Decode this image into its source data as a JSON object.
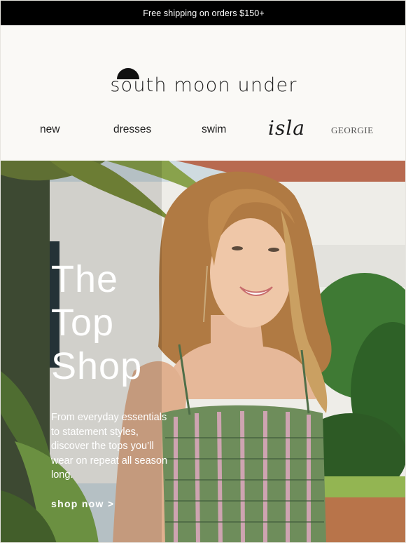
{
  "promo": {
    "text": "Free shipping on orders $150+"
  },
  "brand": {
    "name": "south moon under"
  },
  "nav": {
    "items": [
      {
        "label": "new"
      },
      {
        "label": "dresses"
      },
      {
        "label": "swim"
      },
      {
        "label": "isla"
      },
      {
        "label": "GEORGIE"
      }
    ]
  },
  "hero": {
    "title_lines": [
      "The",
      "Top",
      "Shop"
    ],
    "description": "From everyday essentials to statement styles, discover the tops you’ll wear on repeat all season long.",
    "cta": "shop now >"
  },
  "colors": {
    "promo_bg": "#000000",
    "page_bg": "#faf9f6",
    "text_dark": "#1a1a1a",
    "hero_text": "#ffffff"
  }
}
